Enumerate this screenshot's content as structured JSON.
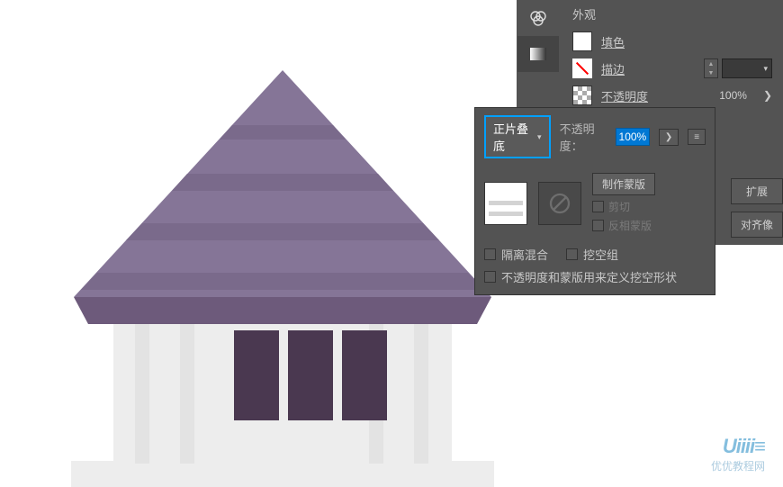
{
  "appearance": {
    "title": "外观",
    "fill_label": "填色",
    "stroke_label": "描边",
    "opacity_label": "不透明度",
    "opacity_value": "100%"
  },
  "transparency": {
    "blend_mode": "正片叠底",
    "opacity_label": "不透明度：",
    "opacity_value": "100%",
    "make_mask": "制作蒙版",
    "clip": "剪切",
    "invert": "反相蒙版",
    "isolate": "隔离混合",
    "knockout": "挖空组",
    "knockout_shape": "不透明度和蒙版用来定义挖空形状"
  },
  "right": {
    "btn_expand": "扩展",
    "btn_align": "对齐像"
  },
  "watermark": {
    "logo": "Uiiii≡",
    "text": "优优教程网"
  }
}
